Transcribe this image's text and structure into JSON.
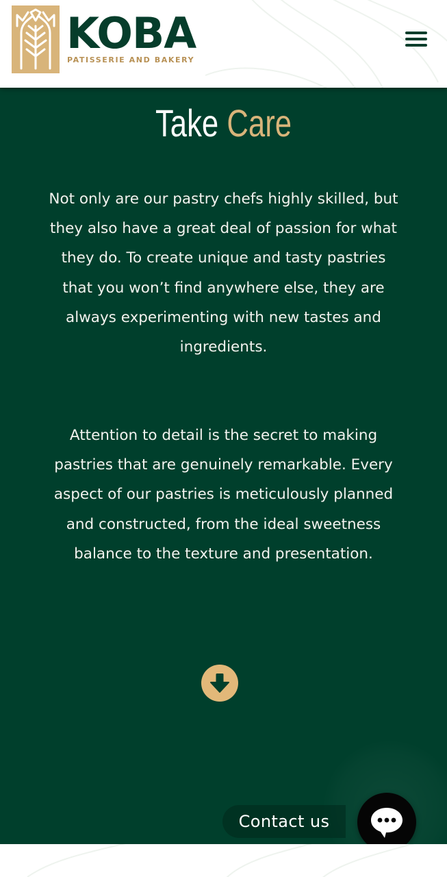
{
  "header": {
    "logo_text": "KOBA",
    "logo_tagline": "PATISSERIE AND BAKERY",
    "menu_icon": "hamburger-menu-icon"
  },
  "section": {
    "title_part1": "Take",
    "title_part2": "Care",
    "paragraphs": [
      "Not only are our pastry chefs highly skilled, but they also have a great deal of passion for what they do. To create unique and tasty pastries that you won’t find anywhere else, they are always experimenting with new tastes and ingredients.",
      "Attention to detail is the secret to making pastries that are genuinely remarkable. Every aspect of our pastries is meticulously planned and constructed, from the ideal sweetness balance to the texture and presentation."
    ],
    "scroll_icon": "arrow-down-circle-icon"
  },
  "contact": {
    "label": "Contact us",
    "icon": "chat-bubble-icon"
  },
  "colors": {
    "brand_green": "#003f2c",
    "logo_green": "#063d2b",
    "gold": "#d8b47a",
    "button_gold": "#e2b879",
    "text_light": "#f2f2ee"
  }
}
